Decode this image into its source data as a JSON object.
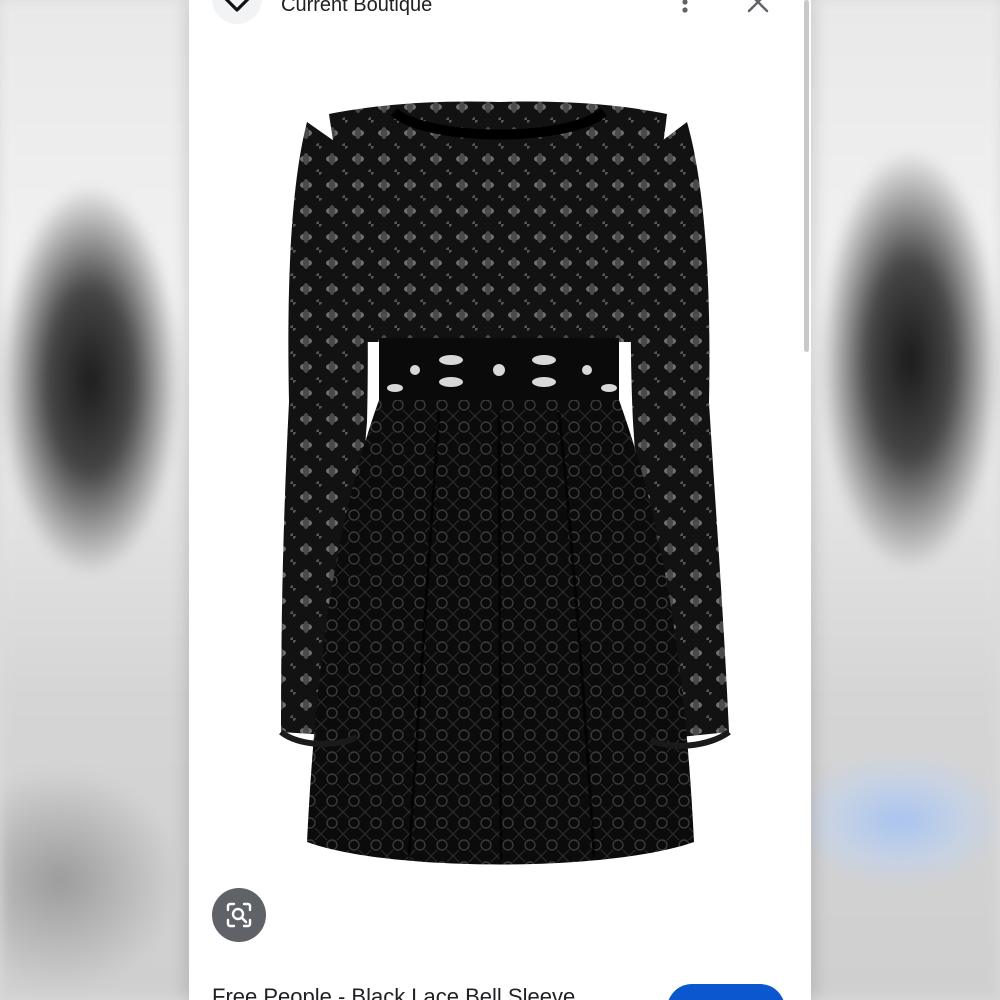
{
  "source": {
    "site_name": "Current Boutique"
  },
  "product": {
    "title": "Free People - Black Lace Bell Sleeve"
  },
  "icons": {
    "site_logo": "heart-logo-icon",
    "more": "more-vertical-icon",
    "close": "close-icon",
    "lens": "google-lens-icon"
  },
  "colors": {
    "accent": "#0b57d0",
    "lens_button": "#5f6368"
  }
}
